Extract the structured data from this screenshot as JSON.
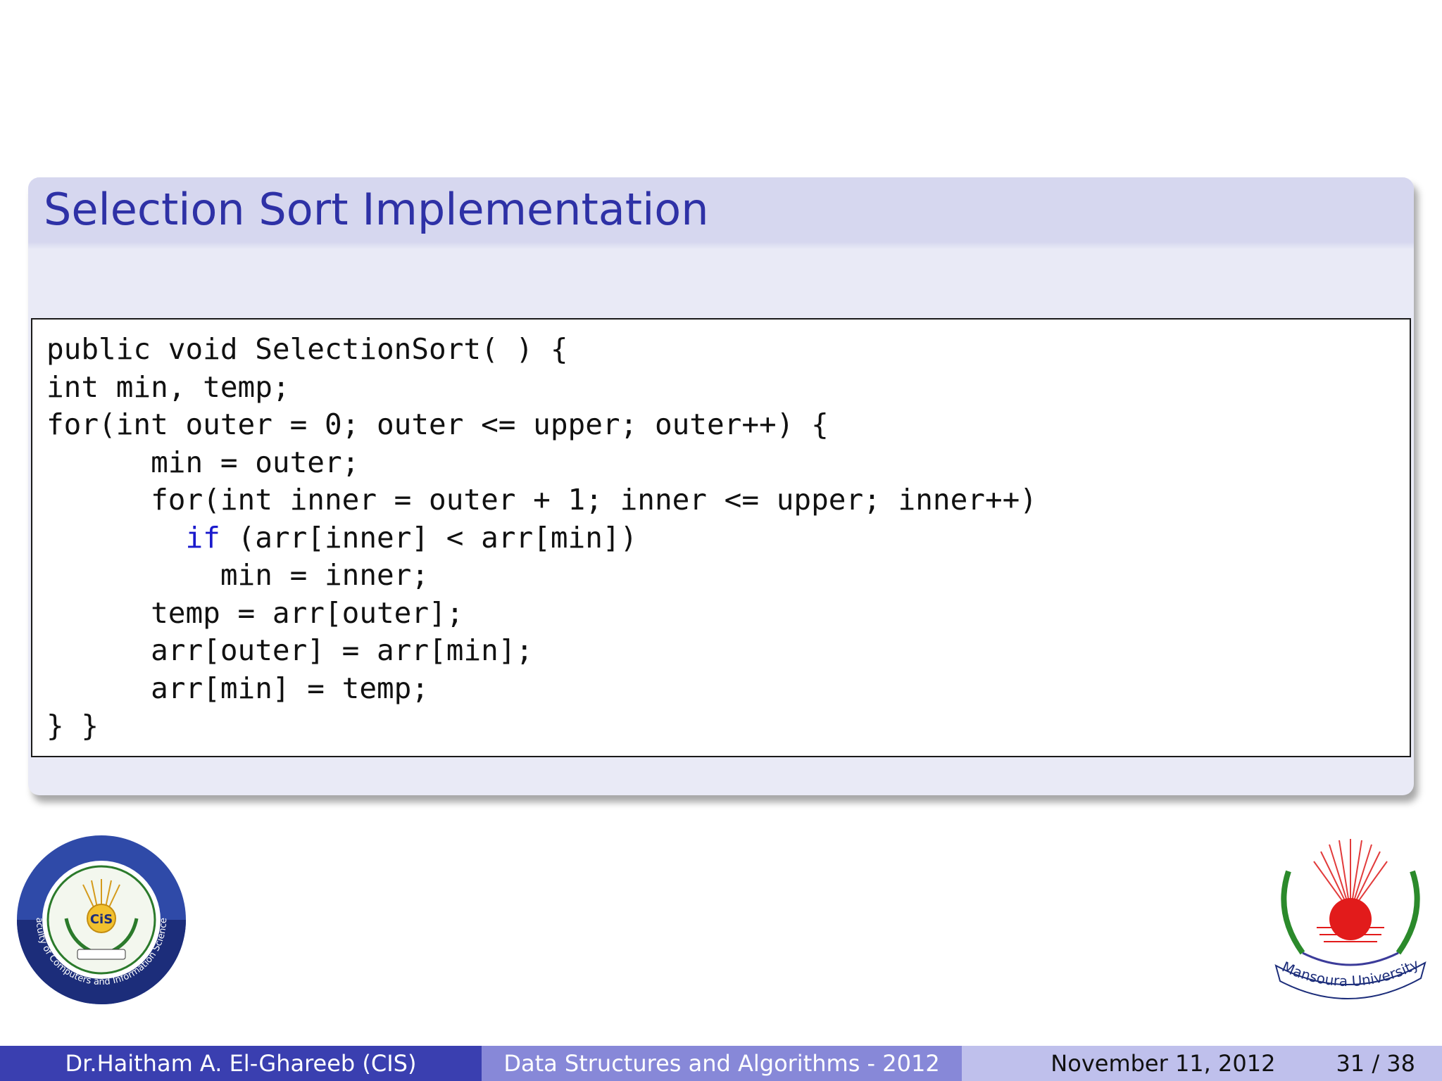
{
  "block": {
    "title": "Selection Sort Implementation"
  },
  "code": {
    "lines": [
      "public void SelectionSort( ) {",
      "int min, temp;",
      "for(int outer = 0; outer <= upper; outer++) {",
      "      min = outer;",
      "      for(int inner = outer + 1; inner <= upper; inner++)",
      "        if (arr[inner] < arr[min])",
      "          min = inner;",
      "      temp = arr[outer];",
      "      arr[outer] = arr[min];",
      "      arr[min] = temp;",
      "} }"
    ]
  },
  "logos": {
    "left": {
      "icon": "faculty-cis-logo",
      "center_text": "CiS",
      "ring_text": "Faculty of Computers and Information Sciences"
    },
    "right": {
      "icon": "mansoura-university-logo",
      "banner_text": "Mansoura University"
    }
  },
  "footer": {
    "author": "Dr.Haitham A. El-Ghareeb  (CIS)",
    "course": "Data Structures and Algorithms - 2012",
    "date": "November 11, 2012",
    "page": "31 / 38"
  },
  "colors": {
    "title": "#2e31a6",
    "keyword": "#1a1acc",
    "footer_left": "#3a3fb0",
    "footer_mid": "#8788d8",
    "footer_right": "#bfc0ec"
  }
}
